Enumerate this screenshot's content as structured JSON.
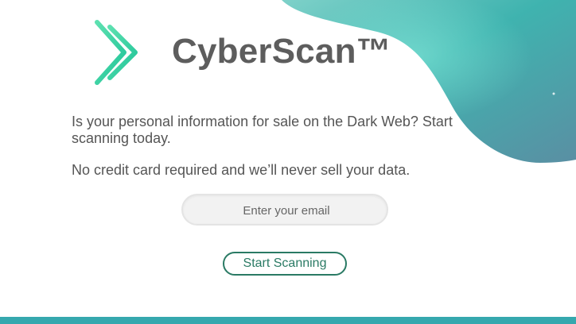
{
  "brand": {
    "name": "CyberScan™",
    "logo_icon": "double-chevron-right-icon"
  },
  "intro": {
    "line1": "Is your personal information for sale on the Dark Web? Start scanning today.",
    "line2": "No credit card required and we’ll never sell your data."
  },
  "form": {
    "email_placeholder": "Enter your email",
    "email_value": "",
    "submit_label": "Start Scanning"
  },
  "colors": {
    "brand_text": "#5d5d5d",
    "logo_gradient": [
      "#5de0b0",
      "#22c79a"
    ],
    "accent_teal": "#2a7a64",
    "wave_gradient": [
      "#6bc9c3",
      "#3aa8a8",
      "#5a8fa3"
    ],
    "bottom_bar": "#35a8ae"
  }
}
